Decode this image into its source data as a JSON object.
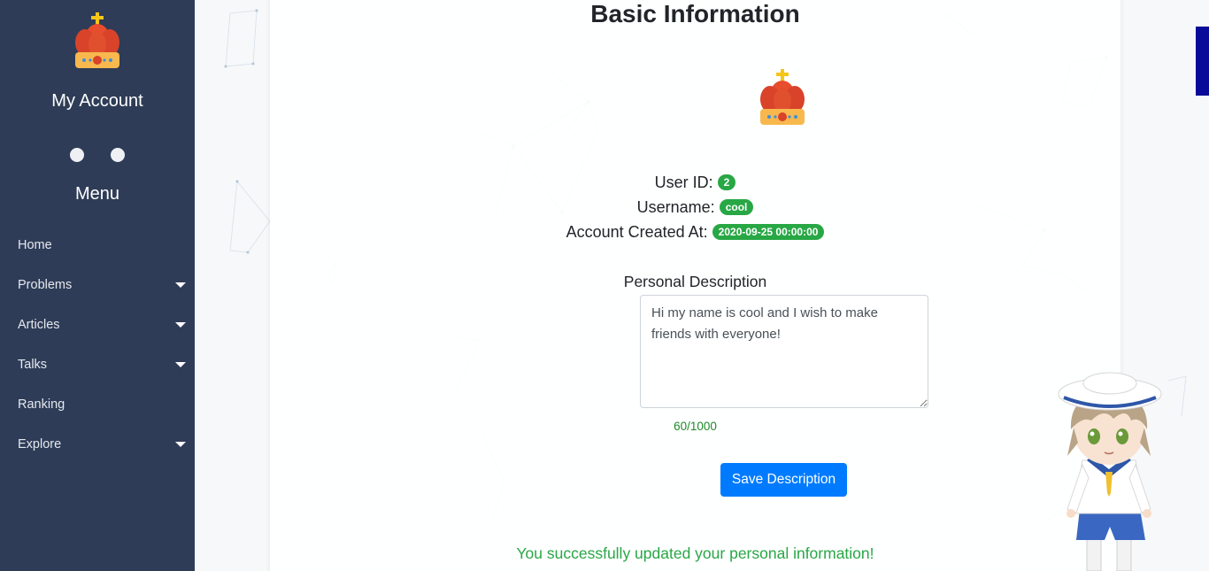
{
  "sidebar": {
    "title": "My Account",
    "menu_title": "Menu",
    "logo_icon": "crown-icon",
    "items": [
      {
        "label": "Home",
        "has_dropdown": false
      },
      {
        "label": "Problems",
        "has_dropdown": true
      },
      {
        "label": "Articles",
        "has_dropdown": true
      },
      {
        "label": "Talks",
        "has_dropdown": true
      },
      {
        "label": "Ranking",
        "has_dropdown": false
      },
      {
        "label": "Explore",
        "has_dropdown": true
      }
    ],
    "colors": {
      "background": "#2e3c57",
      "text": "#ffffff"
    }
  },
  "main": {
    "title": "Basic Information",
    "avatar_icon": "crown-icon",
    "user_id_label": "User ID:",
    "user_id": "2",
    "username_label": "Username:",
    "username": "cool",
    "created_label": "Account Created At:",
    "created_at": "2020-09-25 00:00:00",
    "description_label": "Personal Description",
    "description_value": "Hi my name is cool and I wish to make friends with everyone!",
    "char_count": "60/1000",
    "save_button": "Save Description",
    "success_message": "You successfully updated your personal information!"
  },
  "colors": {
    "badge": "#28a745",
    "primary_button": "#007bff",
    "success_text": "#28a745"
  }
}
